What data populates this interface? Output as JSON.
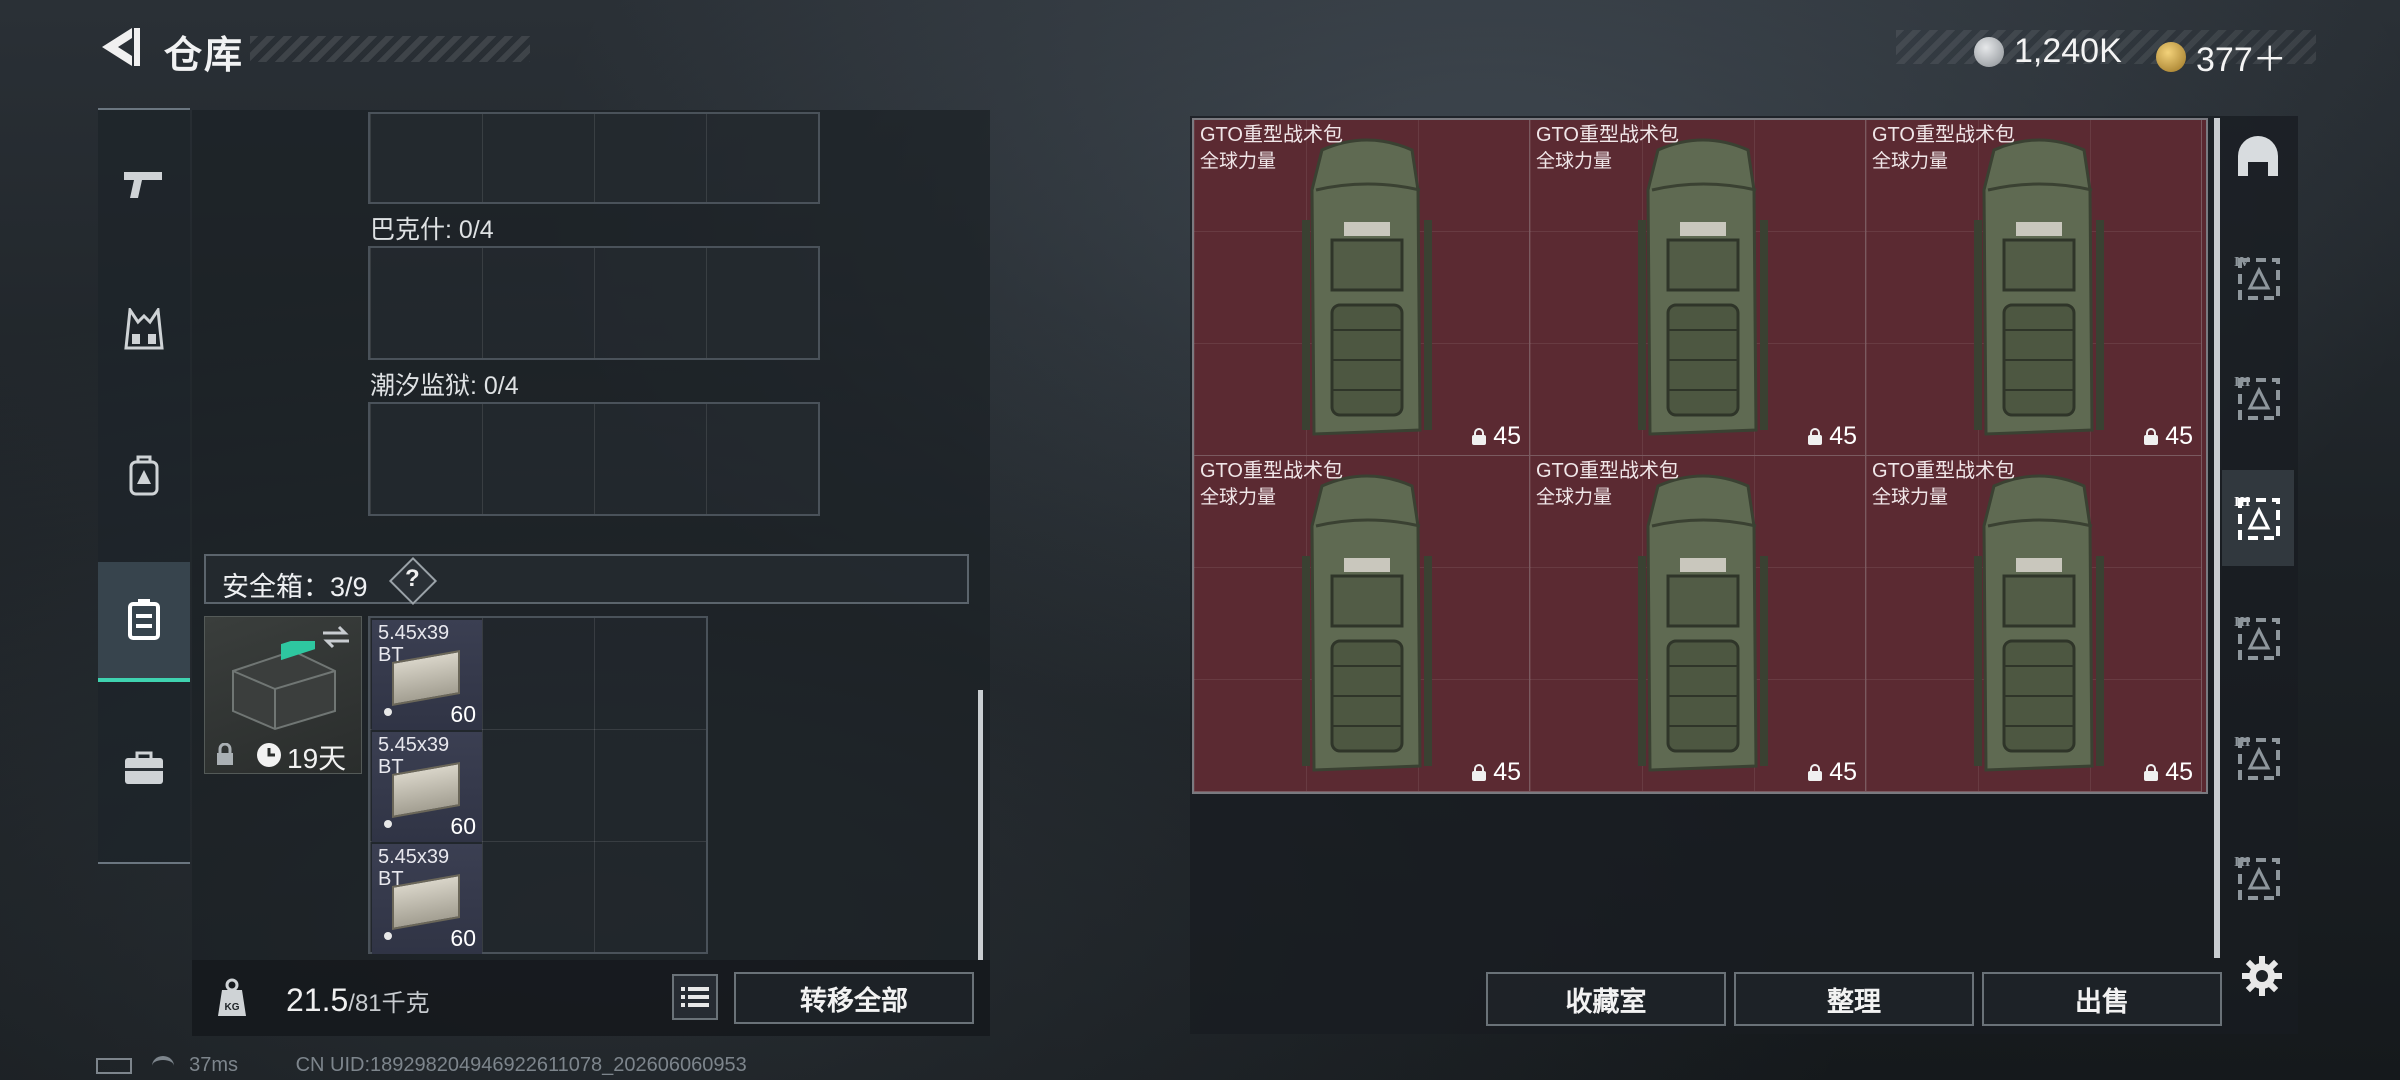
{
  "header": {
    "title": "仓库",
    "currency": [
      {
        "icon": "silver-coin-icon",
        "value": "1,240K",
        "color": "#b8bcc0"
      },
      {
        "icon": "gold-coin-icon",
        "value": "377＋",
        "color": "#c9a24a"
      }
    ]
  },
  "left_nav": [
    {
      "name": "pistol-icon",
      "active": false
    },
    {
      "name": "vest-icon",
      "active": false
    },
    {
      "name": "backpack-icon",
      "active": false
    },
    {
      "name": "safebox-icon",
      "active": true
    },
    {
      "name": "briefcase-icon",
      "active": false
    }
  ],
  "containers": [
    {
      "label": "巴克什: 0/4"
    },
    {
      "label": "潮汐监狱: 0/4"
    }
  ],
  "safebox": {
    "label": "安全箱：3/9",
    "help": "?",
    "duration": "19天"
  },
  "ammo": [
    {
      "name_line1": "5.45x39",
      "name_line2": "BT",
      "count": "60"
    },
    {
      "name_line1": "5.45x39",
      "name_line2": "BT",
      "count": "60"
    },
    {
      "name_line1": "5.45x39",
      "name_line2": "BT",
      "count": "60"
    }
  ],
  "weight": {
    "current": "21.5",
    "max": "/81千克"
  },
  "transfer_all": "转移全部",
  "bags": [
    {
      "name": "GTO重型战术包",
      "sub": "全球力量",
      "count": "45"
    },
    {
      "name": "GTO重型战术包",
      "sub": "全球力量",
      "count": "45"
    },
    {
      "name": "GTO重型战术包",
      "sub": "全球力量",
      "count": "45"
    },
    {
      "name": "GTO重型战术包",
      "sub": "全球力量",
      "count": "45"
    },
    {
      "name": "GTO重型战术包",
      "sub": "全球力量",
      "count": "45"
    },
    {
      "name": "GTO重型战术包",
      "sub": "全球力量",
      "count": "45"
    }
  ],
  "right_tabs": [
    {
      "name": "helmet-icon",
      "roman": ""
    },
    {
      "name": "armor-tier-icon",
      "roman": "IV"
    },
    {
      "name": "container-tier-icon",
      "roman": "III"
    },
    {
      "name": "container-tier-icon",
      "roman": "III"
    },
    {
      "name": "container-tier-icon",
      "roman": "III"
    },
    {
      "name": "container-tier-icon",
      "roman": "III"
    },
    {
      "name": "container-tier-icon",
      "roman": "III"
    }
  ],
  "actions": {
    "collection": "收藏室",
    "organize": "整理",
    "sell": "出售"
  },
  "status": {
    "ping": "37ms",
    "uid": "CN UID:1892982049469226110​78_202606060953"
  }
}
